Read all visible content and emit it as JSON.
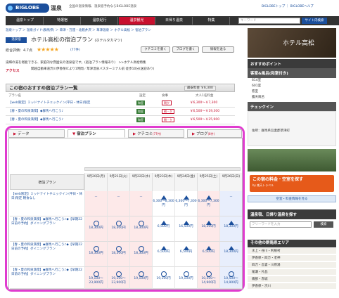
{
  "header": {
    "logo": "BIGLOBE",
    "brand": "温泉",
    "tagline": "全国の温泉情報、温泉宿予約ならBIGLOBE温泉",
    "links": "BIGLOBEトップ ｜ BIGLOBEヘルプ"
  },
  "nav": {
    "items": [
      "温泉トップ",
      "特選宿",
      "温泉紀行",
      "温泉観光",
      "日帰り温泉",
      "特集"
    ],
    "search_placeholder": "キーワード",
    "search_button": "サイト内検索"
  },
  "breadcrumb": "温泉トップ ＞ 温泉ガイド(群馬県) ＞ 草津・万座・北軽井沢 ＞ 草津温泉 ＞ ホテル高松 ＞ 宿泊プラン",
  "hotel": {
    "badge": "温泉宿",
    "title": "ホテル高松の宿泊プラン",
    "kana": "(ホテルタカマツ)"
  },
  "rating": {
    "label": "総合評価：4.7点",
    "stars": "★★★★★",
    "count": "(77件)"
  },
  "buttons": {
    "review": "クチコミを書く",
    "blog": "ブログを書く",
    "report": "情報を送る"
  },
  "description": "湯畑の湯を堪能できる、家庭的な雰囲気の温泉宿です。(宿泊プラン情報あり)　>>ホテル高松特集",
  "access": {
    "label": "アクセス",
    "text": "関越自動車道渋川伊香保ICより1時間／草津温泉バスターミナル前 徒歩10分(送迎あり)"
  },
  "plans": {
    "title": "この宿のおすすめ宿泊プラン一覧",
    "min_price": "最安料金 ￥6,300",
    "cols": [
      "プラン名",
      "設定",
      "食事",
      "大人1名料金"
    ],
    "rows": [
      {
        "name": "【web限定】ミッドナイトチェックイン(平日・休日)限定",
        "tag": "和室",
        "meal": "朝夕",
        "price": "￥6,300～￥7,300"
      },
      {
        "name": "【春・夏の和泉満喫】◆群馬へ行こう♪",
        "tag": "和室",
        "meal": "朝・夕",
        "price": "￥6,500～￥19,300"
      },
      {
        "name": "【春・夏の和泉満喫】◆群馬へ行こう♪",
        "tag": "和室",
        "meal": "朝・夕",
        "price": "￥6,500～￥25,900"
      }
    ]
  },
  "tabs": [
    "データ",
    "宿泊プラン",
    "クチコミ",
    "ブログ"
  ],
  "tab_counts": {
    "review": "(77件)",
    "blog": "(8件)"
  },
  "calendar": {
    "plan_col": "宿泊プラン",
    "dates": [
      "9月20日(月)",
      "9月21日(火)",
      "9月22日(水)",
      "9月23日(木)",
      "9月24日(金)",
      "9月25日(土)",
      "9月26日(日)"
    ],
    "rows": [
      {
        "name": "【web限定】ミッドナイトチェックイン(平日・休日)限定 朝食なし",
        "cells": [
          "－",
          "－",
          "－",
          "6,300～8,300円",
          "6,300～7,300円",
          "6,300～7,300円",
          "－"
        ]
      },
      {
        "name": "【春・夏の和泉満喫】◆群馬へ行こう♪◆【早期22日前の予約】ダイニングプラン",
        "cells": [
          "18,300円",
          "18,300円",
          "18,300円",
          "6,500円",
          "16,500円",
          "18,300円",
          "18,300円"
        ]
      },
      {
        "name": "【春・夏の和泉満喫】◆群馬へ行こう♪◆【早期22日前の予約】ダイニングプラン",
        "cells": [
          "18,300円",
          "18,300円",
          "18,300円",
          "6,500円",
          "6,500円",
          "6,500円",
          "18,300円"
        ]
      },
      {
        "name": "【春・夏の和泉満喫】◆群馬へ行こう♪◆【早期22日前の予約】ダイニングプラン",
        "cells": [
          "19,100～23,900円",
          "19,100～23,900円",
          "19,100円",
          "19,100円",
          "19,100円",
          "10,500～14,900円",
          "10,500～14,900円"
        ]
      }
    ]
  },
  "sidebar": {
    "hero_name": "ホテル高松",
    "osusume": "おすすめポイント",
    "room_title": "客室&風呂(和室付き)",
    "rooms": [
      "614室",
      "601室",
      "客室",
      "露天風呂"
    ],
    "checkin": "チェックイン",
    "address_label": "住所：群馬県吾妻郡草津町",
    "booking": "この宿の料金・空室を探す",
    "booking_sub": "by 楽天トラベル",
    "booking_link": "空室・料金情報を見る",
    "search_title": "温泉宿、日帰り温泉を探す",
    "search_placeholder": "フリーワードを入力",
    "search_button": "検索",
    "area_title": "その他の群馬県エリア",
    "areas": [
      "水上・谷川・利根村",
      "伊香保・四万・老神",
      "四万・吾妻・川原湯",
      "尾瀬・片品",
      "磯部・赤城",
      "伊香保・渋川"
    ]
  }
}
